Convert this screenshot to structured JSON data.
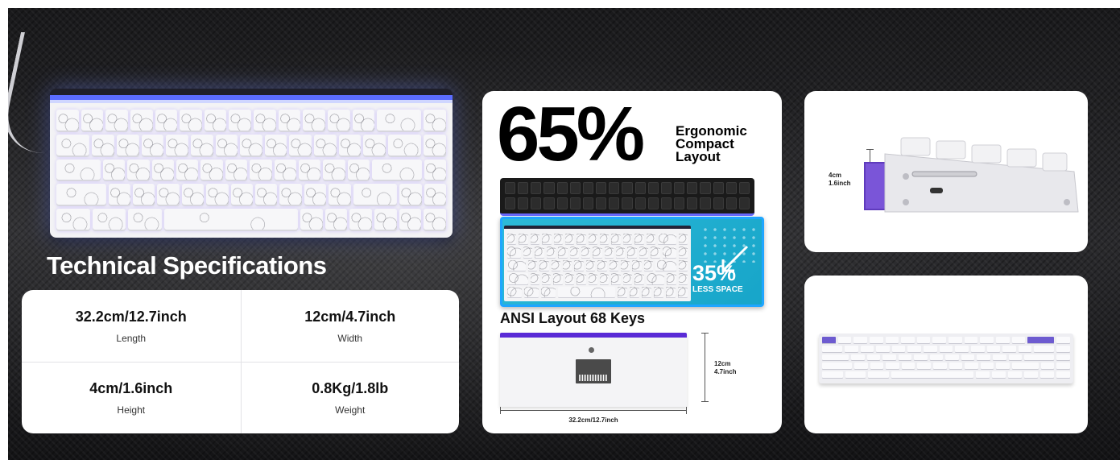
{
  "specs": {
    "title": "Technical Specifications",
    "items": [
      {
        "value": "32.2cm/12.7inch",
        "label": "Length"
      },
      {
        "value": "12cm/4.7inch",
        "label": "Width"
      },
      {
        "value": "4cm/1.6inch",
        "label": "Height"
      },
      {
        "value": "0.8Kg/1.8lb",
        "label": "Weight"
      }
    ]
  },
  "layout_panel": {
    "percent": "65%",
    "tagline": [
      "Ergonomic",
      "Compact",
      "Layout"
    ],
    "saving_percent": "35%",
    "saving_label": "LESS SPACE",
    "ansi_label": "ANSI Layout 68 Keys",
    "dim_height": [
      "12cm",
      "4.7inch"
    ],
    "dim_length": "32.2cm/12.7inch"
  },
  "side_panel": {
    "dim_height": [
      "4cm",
      "1.6inch"
    ]
  },
  "colors": {
    "accent_purple": "#5a2bd6",
    "accent_cyan": "#1fa6ff",
    "rgb_blue": "#5b6cff"
  },
  "icons": [
    "arrow-down-right-icon",
    "usb-c-port-icon"
  ]
}
